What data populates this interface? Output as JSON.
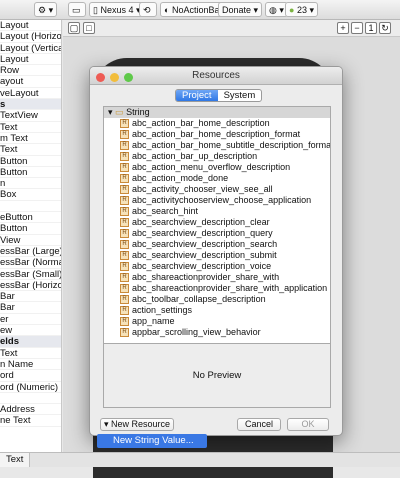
{
  "toolbar": {
    "device": "Nexus 4",
    "theme": "NoActionBar",
    "activity": "Donate",
    "api": "23"
  },
  "palette": {
    "items": [
      {
        "label": "Layout",
        "section": false
      },
      {
        "label": "Layout (Horizontal)",
        "section": false
      },
      {
        "label": "Layout (Vertical)",
        "section": false
      },
      {
        "label": "Layout",
        "section": false
      },
      {
        "label": "Row",
        "section": false
      },
      {
        "label": "ayout",
        "section": false
      },
      {
        "label": "veLayout",
        "section": false
      },
      {
        "label": "s",
        "section": true
      },
      {
        "label": "TextView",
        "section": false
      },
      {
        "label": "Text",
        "section": false
      },
      {
        "label": "m Text",
        "section": false
      },
      {
        "label": "Text",
        "section": false
      },
      {
        "label": "Button",
        "section": false
      },
      {
        "label": "Button",
        "section": false
      },
      {
        "label": "n",
        "section": false
      },
      {
        "label": "Box",
        "section": false
      },
      {
        "label": "",
        "section": false
      },
      {
        "label": "eButton",
        "section": false
      },
      {
        "label": "Button",
        "section": false
      },
      {
        "label": "View",
        "section": false
      },
      {
        "label": "essBar (Large)",
        "section": false
      },
      {
        "label": "essBar (Normal)",
        "section": false
      },
      {
        "label": "essBar (Small)",
        "section": false
      },
      {
        "label": "essBar (Horizontal)",
        "section": false
      },
      {
        "label": "Bar",
        "section": false
      },
      {
        "label": "Bar",
        "section": false
      },
      {
        "label": "er",
        "section": false
      },
      {
        "label": "ew",
        "section": false
      },
      {
        "label": "elds",
        "section": true
      },
      {
        "label": "Text",
        "section": false
      },
      {
        "label": "n Name",
        "section": false
      },
      {
        "label": "ord",
        "section": false
      },
      {
        "label": "ord (Numeric)",
        "section": false
      },
      {
        "label": "",
        "section": false
      },
      {
        "label": "Address",
        "section": false
      },
      {
        "label": "ne Text",
        "section": false
      }
    ]
  },
  "bottom_tab": "Text",
  "dialog": {
    "title": "Resources",
    "tabs": [
      "Project",
      "System"
    ],
    "folder": "String",
    "strings": [
      "abc_action_bar_home_description",
      "abc_action_bar_home_description_format",
      "abc_action_bar_home_subtitle_description_format",
      "abc_action_bar_up_description",
      "abc_action_menu_overflow_description",
      "abc_action_mode_done",
      "abc_activity_chooser_view_see_all",
      "abc_activitychooserview_choose_application",
      "abc_search_hint",
      "abc_searchview_description_clear",
      "abc_searchview_description_query",
      "abc_searchview_description_search",
      "abc_searchview_description_submit",
      "abc_searchview_description_voice",
      "abc_shareactionprovider_share_with",
      "abc_shareactionprovider_share_with_application",
      "abc_toolbar_collapse_description",
      "action_settings",
      "app_name",
      "appbar_scrolling_view_behavior"
    ],
    "preview": "No Preview",
    "new_resource": "New Resource",
    "cancel": "Cancel",
    "ok": "OK",
    "menu_item": "New String Value..."
  }
}
